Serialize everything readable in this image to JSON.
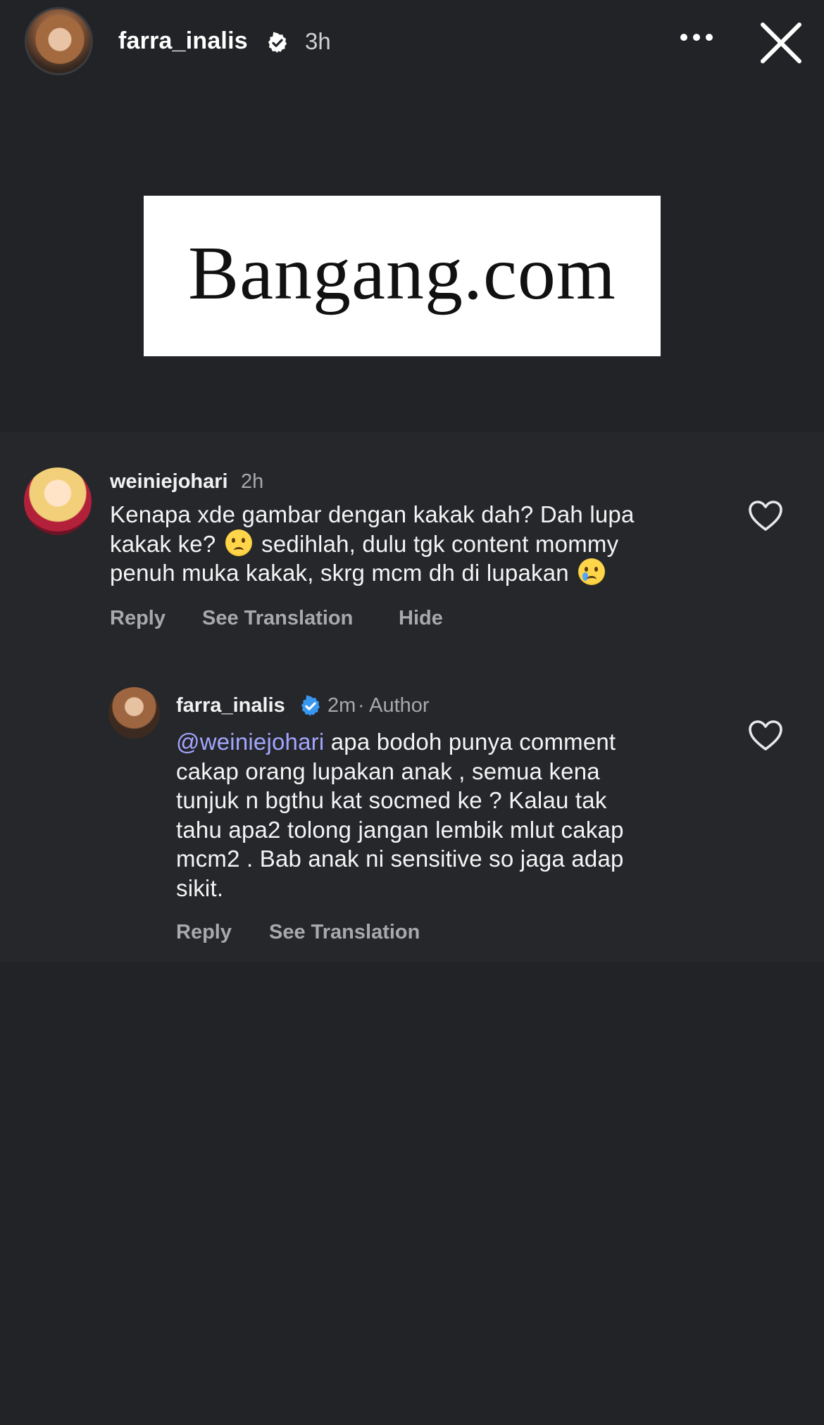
{
  "story": {
    "username": "farra_inalis",
    "time": "3h",
    "verified": true
  },
  "sticker": {
    "text": "Bangang.com"
  },
  "comments": [
    {
      "username": "weiniejohari",
      "time": "2h",
      "lines": [
        "Kenapa xde gambar dengan kakak dah? Dah lupa",
        "kakak ke?",
        "sedihlah, dulu tgk content mommy",
        "penuh muka kakak, skrg mcm dh di lupakan"
      ],
      "actions": [
        "Reply",
        "See Translation",
        "Hide"
      ]
    },
    {
      "username": "farra_inalis",
      "verified": true,
      "time": "2m",
      "role": "· Author",
      "mention": "@weiniejohari",
      "lines": [
        "apa bodoh punya comment",
        "cakap orang lupakan anak , semua kena",
        "tunjuk n bgthu kat socmed ke ? Kalau tak",
        "tahu apa2 tolong jangan lembik mlut cakap",
        "mcm2 . Bab anak ni sensitive so jaga adap",
        "sikit."
      ],
      "actions": [
        "Reply",
        "See Translation"
      ]
    }
  ],
  "icons": {
    "verified": "verified-badge-icon",
    "more": "more-options-icon",
    "close": "close-icon",
    "like": "heart-icon"
  },
  "colors": {
    "background": "#212326",
    "panel": "#25272b",
    "mention": "#a3a6ff",
    "verified": "#3897f0",
    "muted": "#a7a9ad"
  }
}
